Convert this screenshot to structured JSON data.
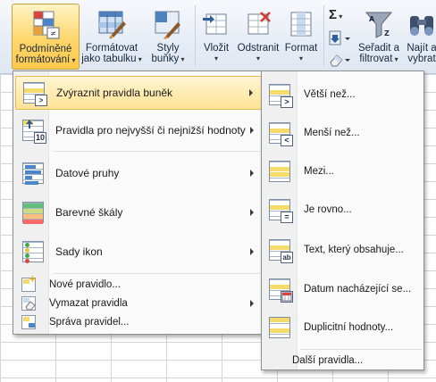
{
  "ribbon": {
    "conditional_formatting": {
      "line1": "Podmíněné",
      "line2": "formátování"
    },
    "format_as_table": {
      "line1": "Formátovat",
      "line2": "jako tabulku"
    },
    "cell_styles": {
      "line1": "Styly",
      "line2": "buňky"
    },
    "insert": {
      "label": "Vložit"
    },
    "delete": {
      "label": "Odstranit"
    },
    "format": {
      "label": "Format"
    },
    "sort_filter": {
      "line1": "Seřadit a",
      "line2": "filtrovat"
    },
    "find_select": {
      "line1": "Najít a",
      "line2": "vybrat"
    }
  },
  "menu": {
    "items": [
      {
        "label": "Zvýraznit pravidla buněk",
        "has_submenu": true
      },
      {
        "label": "Pravidla pro nejvyšší či nejnižší hodnoty",
        "has_submenu": true
      },
      {
        "label": "Datové pruhy",
        "has_submenu": true
      },
      {
        "label": "Barevné škály",
        "has_submenu": true
      },
      {
        "label": "Sady ikon",
        "has_submenu": true
      }
    ],
    "commands": [
      {
        "label": "Nové pravidlo..."
      },
      {
        "label": "Vymazat pravidla",
        "has_submenu": true
      },
      {
        "label": "Správa pravidel..."
      }
    ]
  },
  "submenu": {
    "items": [
      {
        "label": "Větší než...",
        "badge": ">"
      },
      {
        "label": "Menší než...",
        "badge": "<"
      },
      {
        "label": "Mezi...",
        "badge": ""
      },
      {
        "label": "Je rovno...",
        "badge": "="
      },
      {
        "label": "Text, který obsahuje...",
        "badge": "ab"
      },
      {
        "label": "Datum nacházející se...",
        "badge": ""
      },
      {
        "label": "Duplicitní hodnoty...",
        "badge": ""
      }
    ],
    "more": "Další pravidla..."
  },
  "icons": {
    "top_bottom_badge": "10",
    "sigma": "Σ"
  },
  "colors": {
    "highlight_fill": "#ffe394",
    "cell_yellow": "#f5dc6a",
    "accent_blue": "#2e5f9b",
    "bar_blue": "#4a86c8",
    "bar_orange": "#e7a13b",
    "scale_green": "#63be7b",
    "scale_red": "#f8696b"
  }
}
